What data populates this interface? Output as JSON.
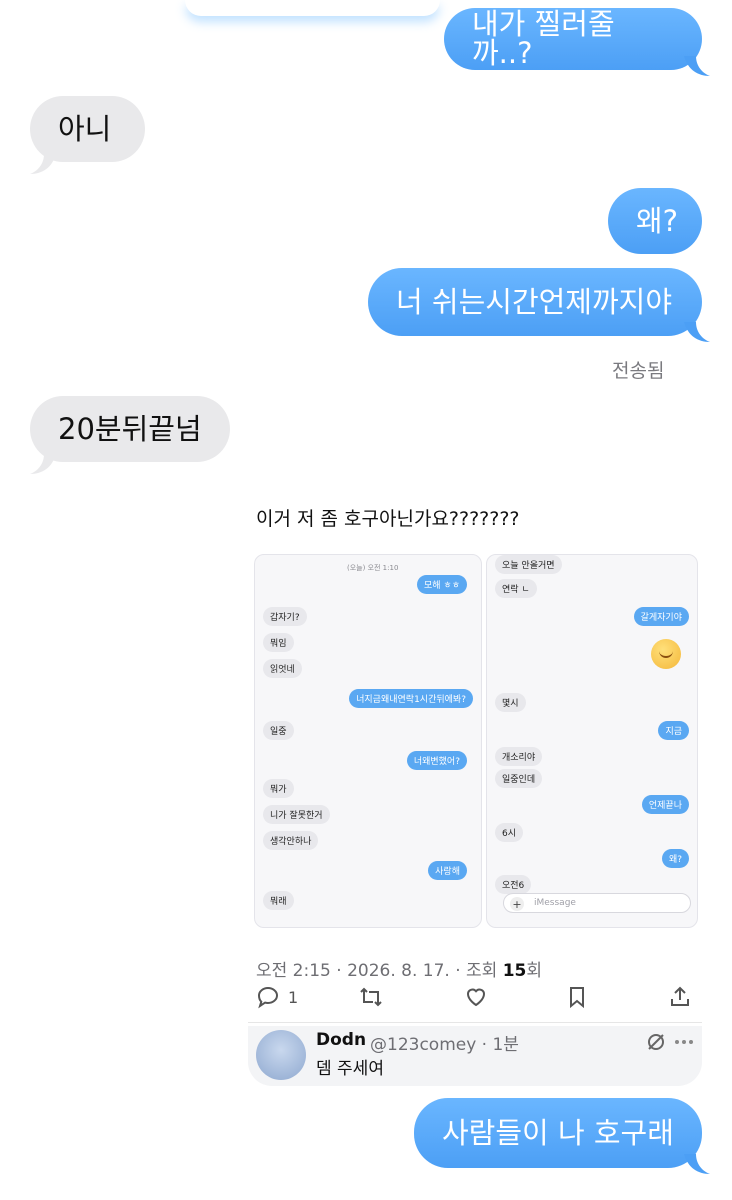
{
  "messages": {
    "m1": "내가 찔러줄까..?",
    "m2": "아니",
    "m3": "왜?",
    "m4": "너 쉬는시간언제까지야",
    "sent_label": "전송됨",
    "m5": "20분뒤끝넘",
    "m6": "사람들이 나 호구래"
  },
  "card": {
    "title": "이거 저 좀 호구아닌가요???????",
    "left_phone": {
      "timestamp": "(오늘) 오전 1:10",
      "bubbles": [
        "모해 ㅎㅎ",
        "갑자기?",
        "뭐임",
        "읽엇네",
        "너지금왜내연락1시간뒤에봐?",
        "일중",
        "너왜변했어?",
        "뭐가",
        "니가 잘못한거",
        "생각안하나",
        "사랑해",
        "뭐래"
      ]
    },
    "right_phone": {
      "bubbles": [
        "오늘 안올거면",
        "연락 ㄴ",
        "갈게자기야",
        "몇시",
        "지금",
        "개소리야",
        "일중인데",
        "언제끝나",
        "6시",
        "왜?",
        "오전6"
      ],
      "input_placeholder": "iMessage"
    },
    "meta": {
      "time": "오전 2:15",
      "date": "2026. 8. 17.",
      "views_label": "조회",
      "views": "15",
      "views_suffix": "회",
      "sep": "·"
    },
    "actions": {
      "reply_count": "1"
    },
    "reply": {
      "name": "Dodn",
      "handle": "@123comey · 1분",
      "text": "뎀 주세여"
    }
  }
}
